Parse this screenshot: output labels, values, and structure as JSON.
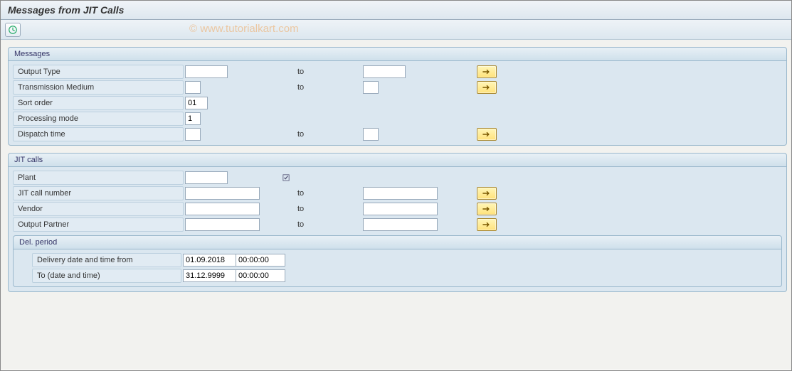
{
  "header": {
    "title": "Messages from JIT Calls"
  },
  "toolbar": {
    "execute_tooltip": "Execute"
  },
  "watermark": "© www.tutorialkart.com",
  "groups": {
    "messages": {
      "title": "Messages",
      "output_type": {
        "label": "Output Type",
        "from": "",
        "to_label": "to",
        "to": ""
      },
      "transmission_medium": {
        "label": "Transmission Medium",
        "from": "",
        "to_label": "to",
        "to": ""
      },
      "sort_order": {
        "label": "Sort order",
        "value": "01"
      },
      "processing_mode": {
        "label": "Processing mode",
        "value": "1"
      },
      "dispatch_time": {
        "label": "Dispatch time",
        "from": "",
        "to_label": "to",
        "to": ""
      }
    },
    "jit_calls": {
      "title": "JIT calls",
      "plant": {
        "label": "Plant",
        "value": ""
      },
      "jit_call_number": {
        "label": "JIT call number",
        "from": "",
        "to_label": "to",
        "to": ""
      },
      "vendor": {
        "label": "Vendor",
        "from": "",
        "to_label": "to",
        "to": ""
      },
      "output_partner": {
        "label": "Output Partner",
        "from": "",
        "to_label": "to",
        "to": ""
      },
      "del_period": {
        "title": "Del. period",
        "from": {
          "label": "Delivery date and time from",
          "date": "01.09.2018",
          "time": "00:00:00"
        },
        "to": {
          "label": "To (date and time)",
          "date": "31.12.9999",
          "time": "00:00:00"
        }
      }
    }
  }
}
